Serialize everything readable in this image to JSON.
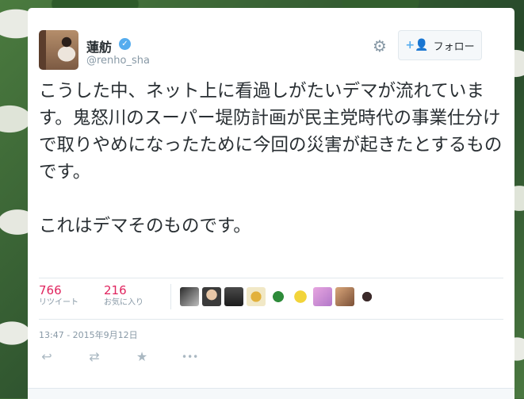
{
  "author": {
    "display_name": "蓮舫",
    "handle": "@renho_sha",
    "verified_icon": "✓"
  },
  "follow_button": {
    "label": "フォロー",
    "icon": "+👤"
  },
  "settings_icon": "⚙",
  "tweet": {
    "text": "こうした中、ネット上に看過しがたいデマが流れています。鬼怒川のスーパー堤防計画が民主党時代の事業仕分けで取りやめになったために今回の災害が起きたとするものです。\n\nこれはデマそのものです。",
    "timestamp": "13:47 - 2015年9月12日"
  },
  "stats": {
    "retweets": {
      "count": "766",
      "label": "リツイート"
    },
    "likes": {
      "count": "216",
      "label": "お気に入り"
    }
  },
  "favoriters_count": 9,
  "actions": {
    "reply_icon": "↩",
    "retweet_icon": "⇄",
    "favorite_icon": "★",
    "more_icon": "•••"
  },
  "colors": {
    "accent": "#55acee",
    "stat_number": "#e0245e",
    "muted": "#8899a6",
    "text": "#292f33"
  }
}
